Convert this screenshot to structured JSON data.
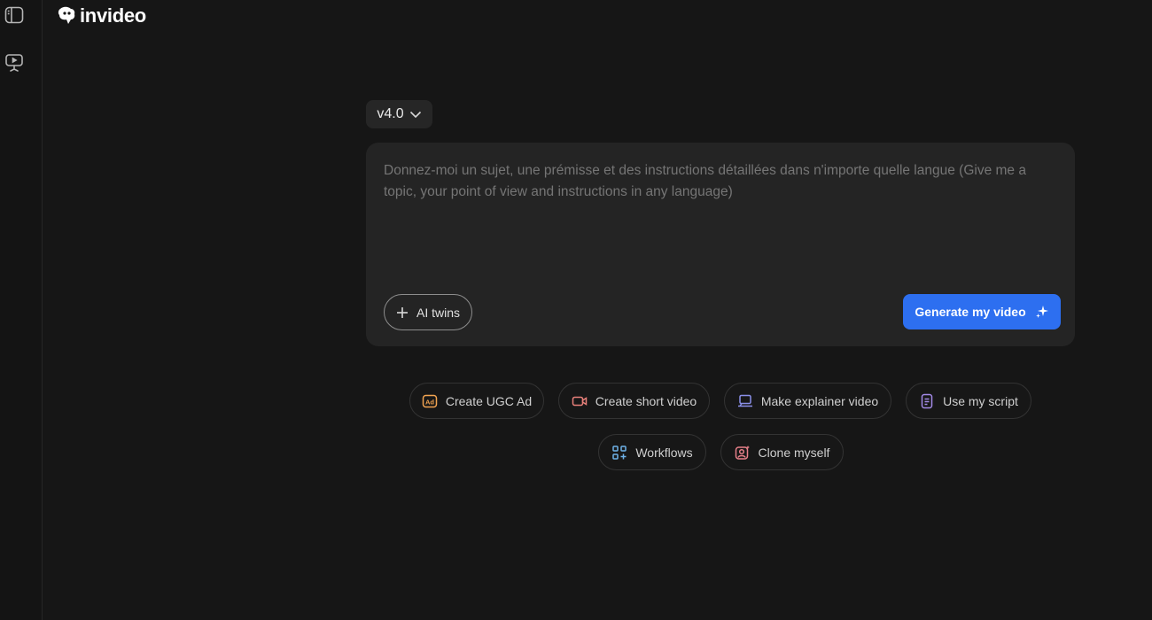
{
  "sidebar": {
    "icons": [
      "sidebar-toggle-icon",
      "presentation-icon"
    ]
  },
  "brand": {
    "name": "invideo"
  },
  "version_selector": {
    "value": "v4.0"
  },
  "prompt": {
    "placeholder": "Donnez-moi un sujet, une prémisse et des instructions détaillées dans n'importe quelle langue (Give me a topic, your point of view and instructions in any language)",
    "value": ""
  },
  "actions": {
    "ai_twins_label": "AI twins",
    "generate_label": "Generate my video"
  },
  "quick_actions": [
    {
      "label": "Create UGC Ad",
      "icon": "ad-icon",
      "color": "#f2a451"
    },
    {
      "label": "Create short video",
      "icon": "video-camera-icon",
      "color": "#e8807a"
    },
    {
      "label": "Make explainer video",
      "icon": "laptop-icon",
      "color": "#8a8fe8"
    },
    {
      "label": "Use my script",
      "icon": "document-icon",
      "color": "#a38ae8"
    },
    {
      "label": "Workflows",
      "icon": "grid-plus-icon",
      "color": "#6fb2e8"
    },
    {
      "label": "Clone myself",
      "icon": "person-sparkle-icon",
      "color": "#e8808a"
    }
  ],
  "colors": {
    "background": "#161616",
    "card": "#242424",
    "accent": "#2d6ff0"
  }
}
